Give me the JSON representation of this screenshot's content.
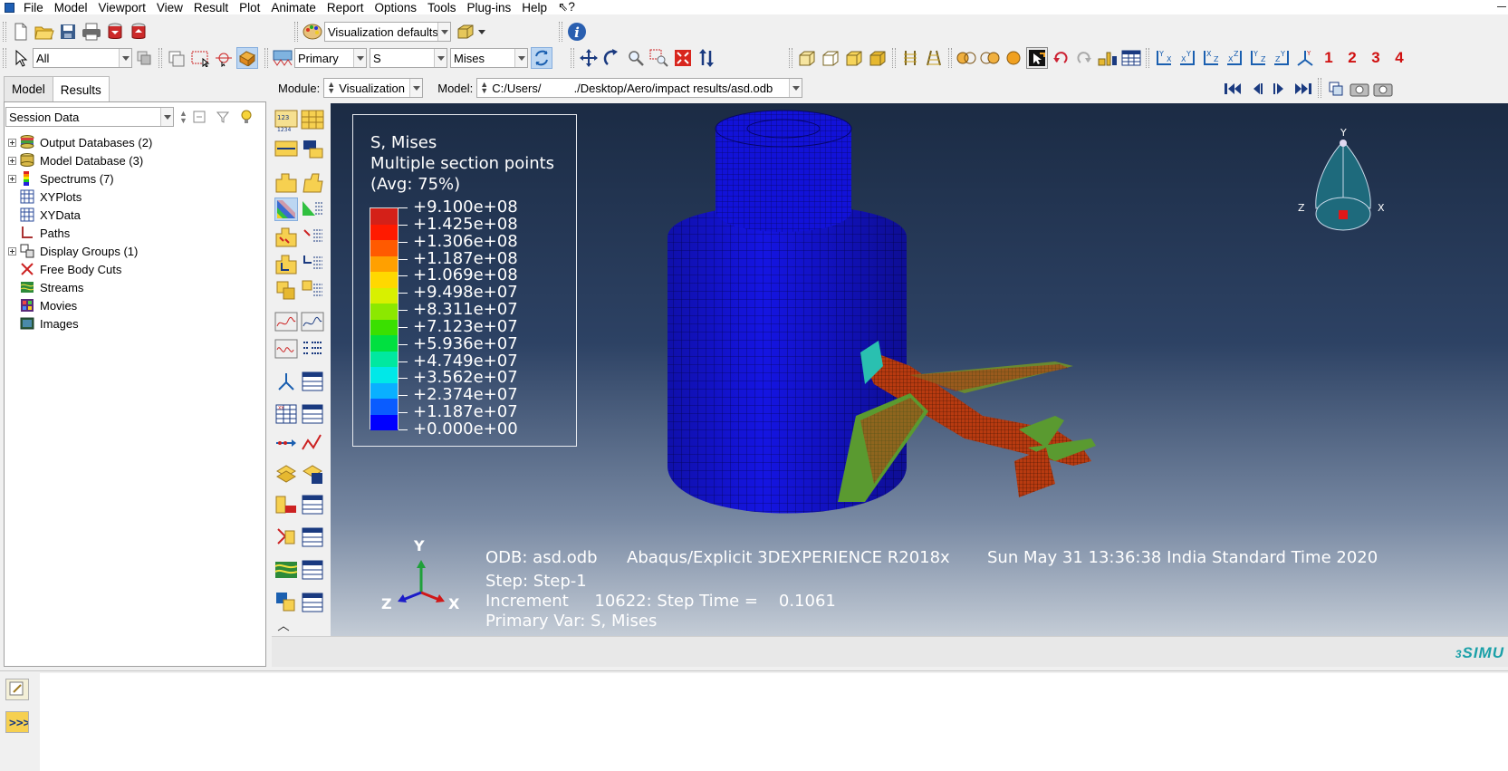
{
  "menu": [
    "File",
    "Model",
    "Viewport",
    "View",
    "Result",
    "Plot",
    "Animate",
    "Report",
    "Options",
    "Tools",
    "Plug-ins",
    "Help",
    "⇖?"
  ],
  "toolbar": {
    "visualization_defaults": "Visualization defaults",
    "selection_filter": "All",
    "field_output": {
      "invariant_type": "Primary",
      "variable": "S",
      "component": "Mises"
    },
    "view_numbers": [
      "1",
      "2",
      "3",
      "4"
    ]
  },
  "context": {
    "module_label": "Module:",
    "module_value": "Visualization",
    "model_label": "Model:",
    "model_value": "C:/Users/          ./Desktop/Aero/impact results/asd.odb"
  },
  "tabs": [
    "Model",
    "Results"
  ],
  "session": {
    "dropdown": "Session Data"
  },
  "tree": [
    {
      "label": "Output Databases (2)",
      "expandable": true,
      "icon": "output-databases-icon"
    },
    {
      "label": "Model Database (3)",
      "expandable": true,
      "icon": "model-database-icon"
    },
    {
      "label": "Spectrums (7)",
      "expandable": true,
      "icon": "spectrums-icon"
    },
    {
      "label": "XYPlots",
      "expandable": false,
      "icon": "xyplots-icon"
    },
    {
      "label": "XYData",
      "expandable": false,
      "icon": "xydata-icon"
    },
    {
      "label": "Paths",
      "expandable": false,
      "icon": "paths-icon"
    },
    {
      "label": "Display Groups (1)",
      "expandable": true,
      "icon": "display-groups-icon"
    },
    {
      "label": "Free Body Cuts",
      "expandable": false,
      "icon": "free-body-cuts-icon"
    },
    {
      "label": "Streams",
      "expandable": false,
      "icon": "streams-icon"
    },
    {
      "label": "Movies",
      "expandable": false,
      "icon": "movies-icon"
    },
    {
      "label": "Images",
      "expandable": false,
      "icon": "images-icon"
    }
  ],
  "legend": {
    "title_lines": [
      "S, Mises",
      "Multiple section points",
      "(Avg: 75%)"
    ],
    "values": [
      "+9.100e+08",
      "+1.425e+08",
      "+1.306e+08",
      "+1.187e+08",
      "+1.069e+08",
      "+9.498e+07",
      "+8.311e+07",
      "+7.123e+07",
      "+5.936e+07",
      "+4.749e+07",
      "+3.562e+07",
      "+2.374e+07",
      "+1.187e+07",
      "+0.000e+00"
    ],
    "colors": [
      "#d42018",
      "#ff1a00",
      "#ff5a00",
      "#ffa000",
      "#ffd800",
      "#d8f000",
      "#8ce800",
      "#3ae000",
      "#00e040",
      "#00e8a0",
      "#00e8e8",
      "#0ab0ff",
      "#0a5cff",
      "#0000ff"
    ]
  },
  "info": {
    "odb": "ODB: asd.odb",
    "solver": "Abaqus/Explicit 3DEXPERIENCE R2018x",
    "date": "Sun May 31 13:36:38 India Standard Time 2020",
    "step": "Step: Step-1",
    "increment": "Increment     10622: Step Time =    0.1061",
    "primary_var": "Primary Var: S, Mises"
  },
  "triad": {
    "x": "X",
    "y": "Y",
    "z": "Z"
  },
  "brand": "SIMU",
  "colors": {
    "model_blue": "#1010e0",
    "viewport_top": "#1b2b44",
    "viewport_bottom": "#c4ccd6",
    "accent": "#1f5fb4"
  }
}
